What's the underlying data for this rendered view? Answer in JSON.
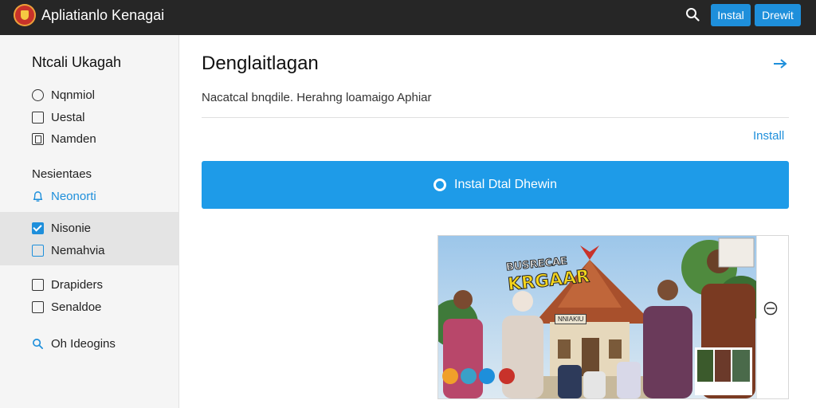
{
  "header": {
    "app_title": "Apliatianlo Kenagai",
    "install_label": "Instal",
    "download_label": "Drewit"
  },
  "sidebar": {
    "title": "Ntcali Ukagah",
    "items": [
      {
        "label": "Nqnmiol",
        "icon": "radio-icon"
      },
      {
        "label": "Uestal",
        "icon": "checkbox-icon"
      },
      {
        "label": "Namden",
        "icon": "checkbox-marked-icon"
      }
    ],
    "section_label": "Nesientaes",
    "notification_label": "Neonorti",
    "selected_items": [
      {
        "label": "Nisonie",
        "checked": true
      },
      {
        "label": "Nemahvia",
        "checked": false
      }
    ],
    "more_items": [
      {
        "label": "Drapiders"
      },
      {
        "label": "Senaldoe"
      }
    ],
    "search_label": "Oh Ideogins"
  },
  "main": {
    "title": "Denglaitlagan",
    "subtitle": "Nacatcal bnqdile. Herahng loamaigo Aphiar",
    "install_link": "Install",
    "cta_label": "Instal Dtal Dhewin",
    "preview": {
      "poster_line1": "BUSRECAE",
      "poster_line2": "KRGAAR",
      "sign_text": "NNIAKIU"
    }
  },
  "colors": {
    "topbar": "#262626",
    "accent": "#1e8fdb",
    "cta": "#1e9be8",
    "sidebar_bg": "#f5f5f5"
  }
}
